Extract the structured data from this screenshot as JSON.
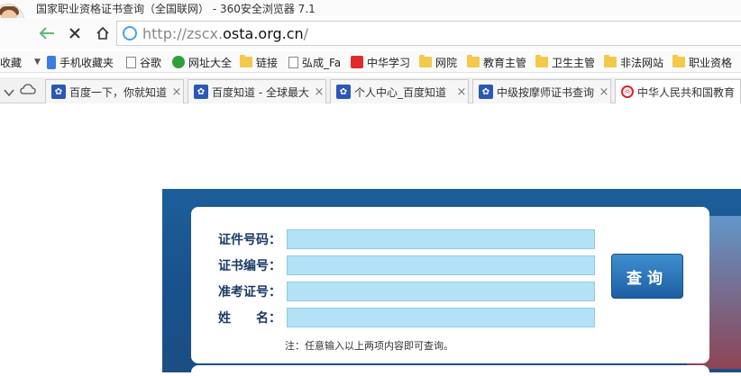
{
  "window": {
    "title": "国家职业资格证书查询（全国联网） - 360安全浏览器 7.1"
  },
  "address_bar": {
    "scheme": "http://zscx.",
    "host": "osta.org.cn",
    "path": "/"
  },
  "bookmarks": {
    "collapsed_label": "收藏",
    "items": [
      {
        "label": "手机收藏夹",
        "icon": "phone-icon"
      },
      {
        "label": "谷歌",
        "icon": "page-icon"
      },
      {
        "label": "网址大全",
        "icon": "globe-icon"
      },
      {
        "label": "链接",
        "icon": "folder-icon"
      },
      {
        "label": "弘成_Fa",
        "icon": "page-icon"
      },
      {
        "label": "中华学习",
        "icon": "red-c-icon"
      },
      {
        "label": "网院",
        "icon": "folder-icon"
      },
      {
        "label": "教育主管",
        "icon": "folder-icon"
      },
      {
        "label": "卫生主管",
        "icon": "folder-icon"
      },
      {
        "label": "非法网站",
        "icon": "folder-icon"
      },
      {
        "label": "职业资格",
        "icon": "folder-icon"
      }
    ]
  },
  "tabs": [
    {
      "label": "百度一下，你就知道",
      "icon": "baidu-paw-icon"
    },
    {
      "label": "百度知道 - 全球最大",
      "icon": "baidu-paw-icon"
    },
    {
      "label": "个人中心_百度知道",
      "icon": "baidu-paw-icon"
    },
    {
      "label": "中级按摩师证书查询",
      "icon": "baidu-paw-icon"
    },
    {
      "label": "中华人民共和国教育",
      "icon": "gov-emblem-icon"
    }
  ],
  "form": {
    "fields": [
      {
        "label": "证件号码：",
        "value": ""
      },
      {
        "label": "证书编号：",
        "value": ""
      },
      {
        "label": "准考证号：",
        "value": ""
      },
      {
        "label": "姓　　名：",
        "value": ""
      }
    ],
    "submit_label": "查询",
    "note": "注：任意输入以上两项内容即可查询。"
  },
  "colors": {
    "banner_blue": "#1d5e9a",
    "field_bg": "#b3e2f6",
    "label_color": "#1a3b66",
    "button_blue": "#2b6fb3"
  }
}
